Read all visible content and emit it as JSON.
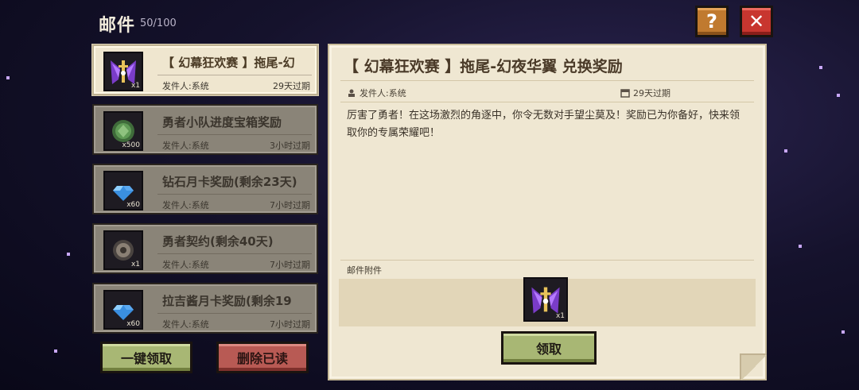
{
  "header": {
    "title": "邮件",
    "count": "50/100"
  },
  "icons": {
    "help": "?",
    "close": "✕"
  },
  "mails": [
    {
      "title": "【 幻幕狂欢赛 】拖尾-幻",
      "sender": "发件人:系统",
      "expire": "29天过期",
      "qty": "x1",
      "icon": "purple-wings-icon",
      "active": true
    },
    {
      "title": "勇者小队进度宝箱奖励",
      "sender": "发件人:系统",
      "expire": "3小时过期",
      "qty": "x500",
      "icon": "green-coin-icon",
      "active": false
    },
    {
      "title": "钻石月卡奖励(剩余23天)",
      "sender": "发件人:系统",
      "expire": "7小时过期",
      "qty": "x60",
      "icon": "diamond-icon",
      "active": false
    },
    {
      "title": "勇者契约(剩余40天)",
      "sender": "发件人:系统",
      "expire": "7小时过期",
      "qty": "x1",
      "icon": "contract-coin-icon",
      "active": false
    },
    {
      "title": "拉吉酱月卡奖励(剩余19",
      "sender": "发件人:系统",
      "expire": "7小时过期",
      "qty": "x60",
      "icon": "diamond-icon",
      "active": false
    }
  ],
  "buttons": {
    "claim_all": "一键领取",
    "delete_read": "删除已读",
    "claim": "领取"
  },
  "detail": {
    "title": "【 幻幕狂欢赛 】拖尾-幻夜华翼 兑换奖励",
    "sender": "发件人:系统",
    "expire": "29天过期",
    "body": "厉害了勇者！在这场激烈的角逐中，你令无数对手望尘莫及！奖励已为你备好，快来领取你的专属荣耀吧！",
    "attachment_label": "邮件附件",
    "attachment_qty": "x1"
  },
  "colors": {
    "accent_gold": "#c07a2f",
    "close_red": "#c8362f",
    "claim_green": "#a8b774",
    "delete_red": "#b85a54"
  }
}
